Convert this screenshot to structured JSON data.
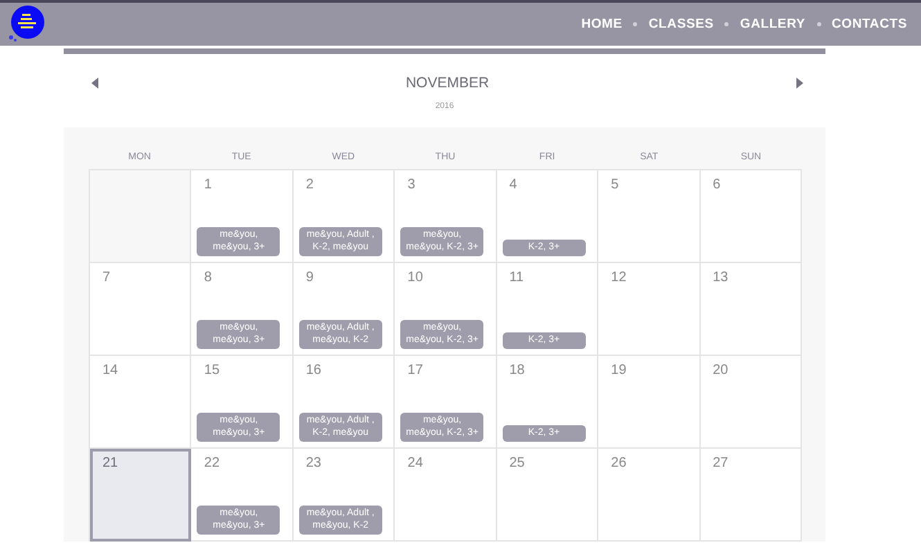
{
  "nav": {
    "items": [
      "HOME",
      "CLASSES",
      "GALLERY",
      "CONTACTS"
    ]
  },
  "calendar": {
    "month": "NOVEMBER",
    "year": "2016",
    "weekdays": [
      "MON",
      "TUE",
      "WED",
      "THU",
      "FRI",
      "SAT",
      "SUN"
    ],
    "days": [
      {
        "selected": false
      },
      {
        "day": "1",
        "selected": false,
        "events": [
          "me&you, me&you, 3+"
        ]
      },
      {
        "day": "2",
        "selected": false,
        "events": [
          "me&you, Adult , K-2, me&you"
        ]
      },
      {
        "day": "3",
        "selected": false,
        "events": [
          "me&you, me&you, K-2, 3+"
        ]
      },
      {
        "day": "4",
        "selected": false,
        "events": [
          "K-2, 3+"
        ]
      },
      {
        "day": "5",
        "selected": false
      },
      {
        "day": "6",
        "selected": false
      },
      {
        "day": "7",
        "selected": false
      },
      {
        "day": "8",
        "selected": false,
        "events": [
          "me&you, me&you, 3+"
        ]
      },
      {
        "day": "9",
        "selected": false,
        "events": [
          "me&you, Adult , me&you, K-2"
        ]
      },
      {
        "day": "10",
        "selected": false,
        "events": [
          "me&you, me&you, K-2, 3+"
        ]
      },
      {
        "day": "11",
        "selected": false,
        "events": [
          "K-2, 3+"
        ]
      },
      {
        "day": "12",
        "selected": false
      },
      {
        "day": "13",
        "selected": false
      },
      {
        "day": "14",
        "selected": false
      },
      {
        "day": "15",
        "selected": false,
        "events": [
          "me&you, me&you, 3+"
        ]
      },
      {
        "day": "16",
        "selected": false,
        "events": [
          "me&you, Adult , K-2, me&you"
        ]
      },
      {
        "day": "17",
        "selected": false,
        "events": [
          "me&you, me&you, K-2, 3+"
        ]
      },
      {
        "day": "18",
        "selected": false,
        "events": [
          "K-2, 3+"
        ]
      },
      {
        "day": "19",
        "selected": false
      },
      {
        "day": "20",
        "selected": false
      },
      {
        "day": "21",
        "selected": true
      },
      {
        "day": "22",
        "selected": false,
        "events": [
          "me&you, me&you, 3+"
        ]
      },
      {
        "day": "23",
        "selected": false,
        "events": [
          "me&you, Adult , me&you, K-2"
        ]
      },
      {
        "day": "24",
        "selected": false
      },
      {
        "day": "25",
        "selected": false
      },
      {
        "day": "26",
        "selected": false
      },
      {
        "day": "27",
        "selected": false
      }
    ]
  }
}
